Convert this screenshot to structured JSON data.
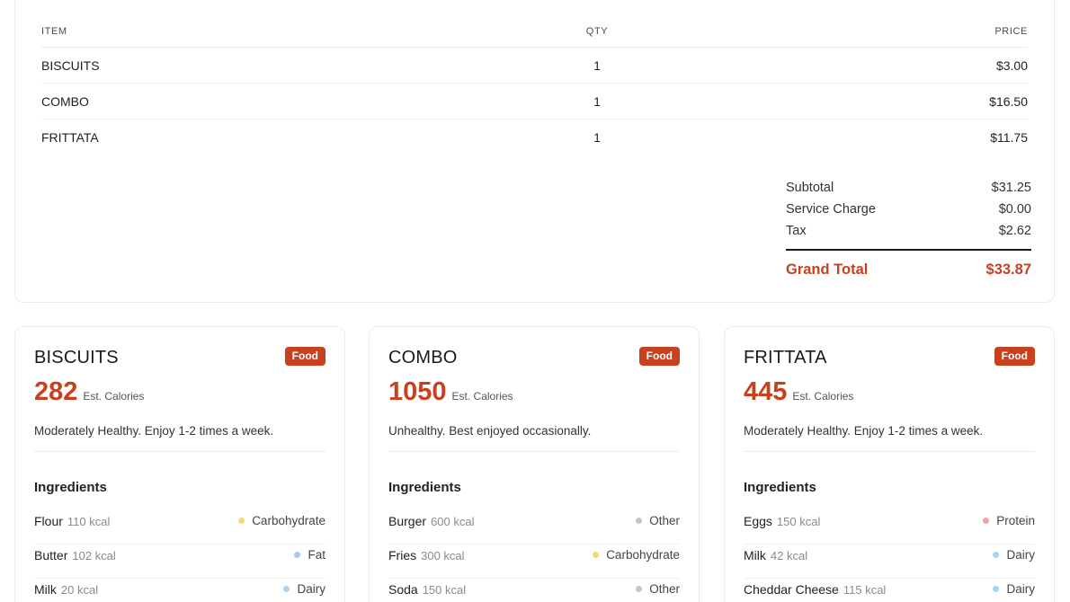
{
  "receipt": {
    "headers": {
      "item": "ITEM",
      "qty": "QTY",
      "price": "PRICE"
    },
    "rows": [
      {
        "name": "BISCUITS",
        "qty": "1",
        "price": "$3.00"
      },
      {
        "name": "COMBO",
        "qty": "1",
        "price": "$16.50"
      },
      {
        "name": "FRITTATA",
        "qty": "1",
        "price": "$11.75"
      }
    ],
    "totals": {
      "subtotal_label": "Subtotal",
      "subtotal": "$31.25",
      "service_label": "Service Charge",
      "service": "$0.00",
      "tax_label": "Tax",
      "tax": "$2.62",
      "grand_label": "Grand Total",
      "grand": "$33.87"
    }
  },
  "colors": {
    "accent": "#c8401e",
    "carbohydrate": "#f7d774",
    "fat": "#a8c8f0",
    "dairy": "#a8d4f0",
    "other": "#c4c4c4",
    "protein": "#f4a0a8"
  },
  "cards": [
    {
      "title": "BISCUITS",
      "badge": "Food",
      "calories": "282",
      "cal_unit": "Est. Calories",
      "health": "Moderately Healthy. Enjoy 1-2 times a week.",
      "ingredients_title": "Ingredients",
      "ingredients": [
        {
          "name": "Flour",
          "kcal": "110 kcal",
          "category": "Carbohydrate",
          "dot": "#f7d774"
        },
        {
          "name": "Butter",
          "kcal": "102 kcal",
          "category": "Fat",
          "dot": "#a8c8f0"
        },
        {
          "name": "Milk",
          "kcal": "20 kcal",
          "category": "Dairy",
          "dot": "#a8d4f0"
        }
      ]
    },
    {
      "title": "COMBO",
      "badge": "Food",
      "calories": "1050",
      "cal_unit": "Est. Calories",
      "health": "Unhealthy. Best enjoyed occasionally.",
      "ingredients_title": "Ingredients",
      "ingredients": [
        {
          "name": "Burger",
          "kcal": "600 kcal",
          "category": "Other",
          "dot": "#c4c4c4"
        },
        {
          "name": "Fries",
          "kcal": "300 kcal",
          "category": "Carbohydrate",
          "dot": "#f7d774"
        },
        {
          "name": "Soda",
          "kcal": "150 kcal",
          "category": "Other",
          "dot": "#c4c4c4"
        }
      ]
    },
    {
      "title": "FRITTATA",
      "badge": "Food",
      "calories": "445",
      "cal_unit": "Est. Calories",
      "health": "Moderately Healthy. Enjoy 1-2 times a week.",
      "ingredients_title": "Ingredients",
      "ingredients": [
        {
          "name": "Eggs",
          "kcal": "150 kcal",
          "category": "Protein",
          "dot": "#f4a0a8"
        },
        {
          "name": "Milk",
          "kcal": "42 kcal",
          "category": "Dairy",
          "dot": "#a8d4f0"
        },
        {
          "name": "Cheddar Cheese",
          "kcal": "115 kcal",
          "category": "Dairy",
          "dot": "#a8d4f0"
        }
      ]
    }
  ]
}
